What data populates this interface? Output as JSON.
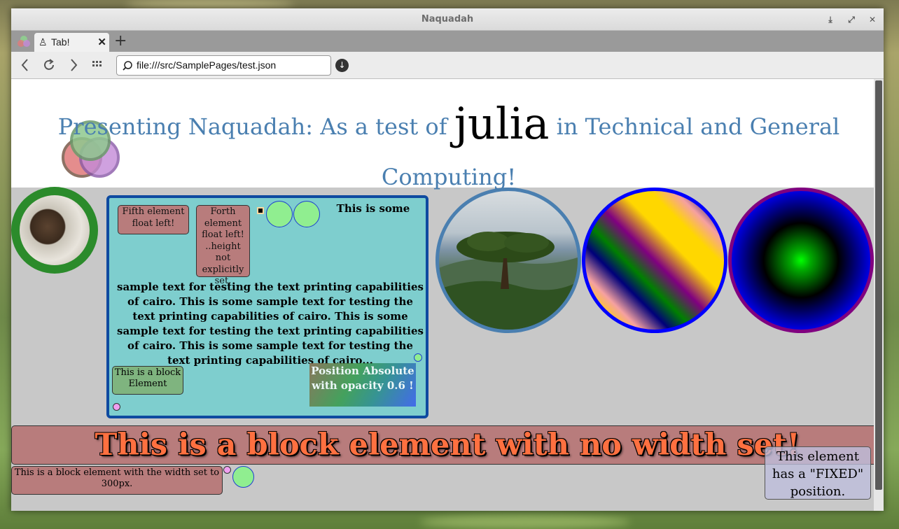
{
  "window": {
    "title": "Naquadah"
  },
  "tabs": [
    {
      "label": "Tab!"
    }
  ],
  "navbar": {
    "url": "file:///src/SamplePages/test.json"
  },
  "header": {
    "title_before": "Presenting Naquadah: As a test of ",
    "title_highlight": "julia",
    "title_after": " in Technical and General Computing!"
  },
  "content": {
    "fifth_float": "Fifth element float left!",
    "forth_float": "Forth element float left! ..height not explicitly set.",
    "body_text_first": "This is some",
    "body_text_rest": "sample text for testing the text printing capabilities of cairo. This is some sample text for testing the text printing capabilities of cairo. This is some sample text for testing the text printing capabilities of cairo. This is some sample text for testing the text printing capabilities of cairo...",
    "block_element": "This is a block Element",
    "absolute_box": "Position Absolute with opacity 0.6 !",
    "no_width_block": "This is a block element with no width set!",
    "width300_block": "This is a block element with the width set to 300px.",
    "fixed_element": "This element has a \"FIXED\" position."
  },
  "colors": {
    "title_blue": "#4a7fb0",
    "cyan_box": "#7ecece",
    "rose_block": "#b87c7c",
    "green_block": "#7fb47f",
    "orange_text": "#ff7040"
  }
}
